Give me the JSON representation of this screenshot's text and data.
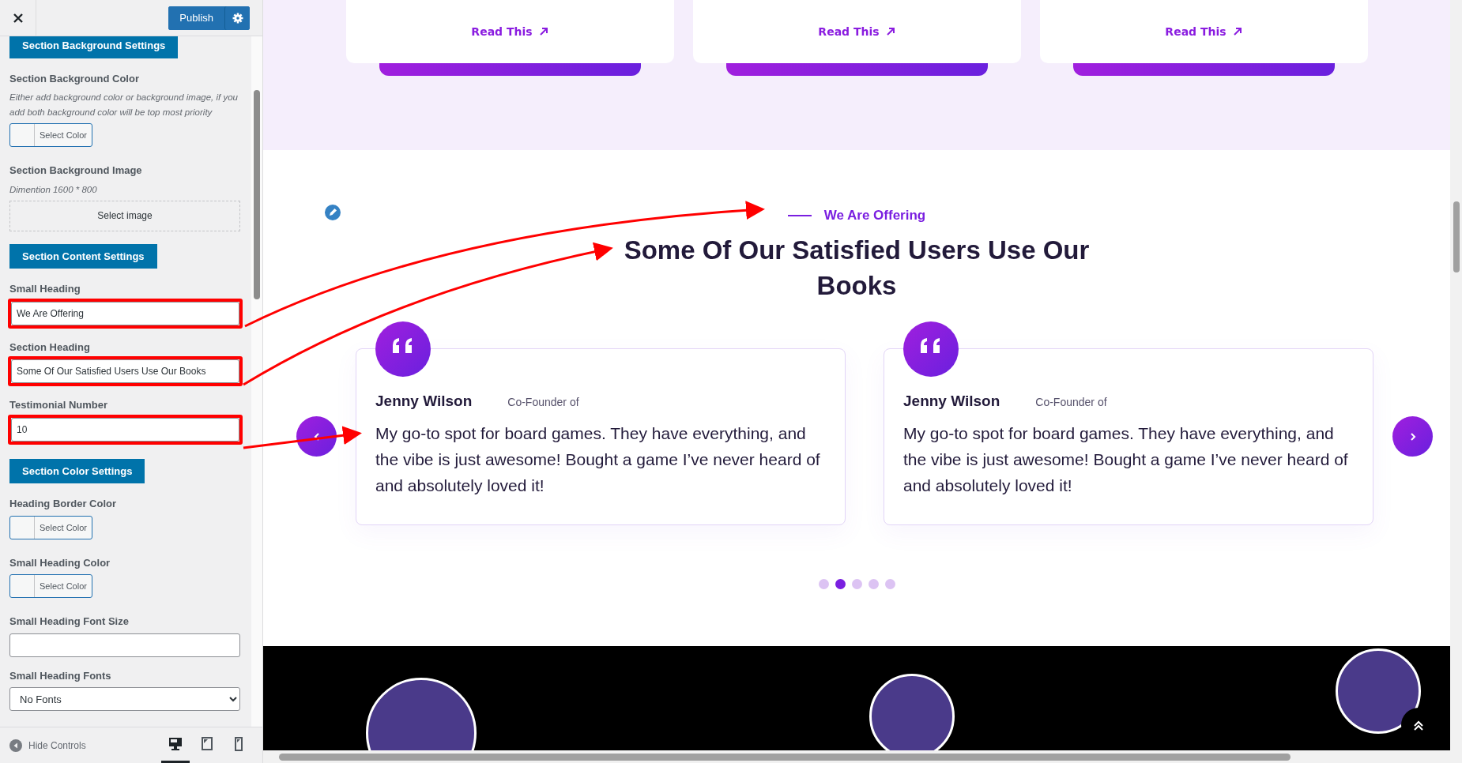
{
  "sidebar": {
    "publish_button": "Publish",
    "items": [
      {
        "kind": "section-button",
        "label": "Section Background Settings"
      },
      {
        "kind": "color",
        "label": "Section Background Color",
        "description": "Either add background color or background image, if you add both background color will be top most priority",
        "button": "Select Color"
      },
      {
        "kind": "image",
        "label": "Section Background Image",
        "description": "Dimention 1600 * 800",
        "button": "Select image"
      },
      {
        "kind": "section-button",
        "label": "Section Content Settings"
      },
      {
        "kind": "text",
        "label": "Small Heading",
        "value": "We Are Offering",
        "highlighted": true
      },
      {
        "kind": "text",
        "label": "Section Heading",
        "value": "Some Of Our Satisfied Users Use Our Books",
        "highlighted": true
      },
      {
        "kind": "text",
        "label": "Testimonial Number",
        "value": "10",
        "highlighted": true
      },
      {
        "kind": "section-button",
        "label": "Section Color Settings"
      },
      {
        "kind": "color",
        "label": "Heading Border Color",
        "button": "Select Color"
      },
      {
        "kind": "color",
        "label": "Small Heading Color",
        "button": "Select Color"
      },
      {
        "kind": "text",
        "label": "Small Heading Font Size",
        "highlighted": false
      },
      {
        "kind": "select",
        "label": "Small Heading Fonts",
        "value": "No Fonts"
      }
    ],
    "footer": {
      "hide_controls": "Hide Controls",
      "devices": [
        {
          "kind": "desktop",
          "selected": true
        },
        {
          "kind": "tablet",
          "selected": false
        },
        {
          "kind": "mobile",
          "selected": false
        }
      ]
    }
  },
  "preview": {
    "cards": [
      {
        "link": "Read This"
      },
      {
        "link": "Read This"
      },
      {
        "link": "Read This"
      }
    ],
    "small_heading": "We Are Offering",
    "heading": "Some Of Our Satisfied Users Use Our Books",
    "testimonials": [
      {
        "name": "Jenny Wilson",
        "role": "Co-Founder of",
        "text": "My go-to spot for board games. They have everything, and the vibe is just awesome! Bought a game I’ve never heard of and absolutely loved it!"
      },
      {
        "name": "Jenny Wilson",
        "role": "Co-Founder of",
        "text": "My go-to spot for board games. They have everything, and the vibe is just awesome! Bought a game I’ve never heard of and absolutely loved it!"
      }
    ],
    "dots": [
      {
        "selected": false
      },
      {
        "selected": true
      },
      {
        "selected": false
      },
      {
        "selected": false
      },
      {
        "selected": false
      }
    ]
  }
}
